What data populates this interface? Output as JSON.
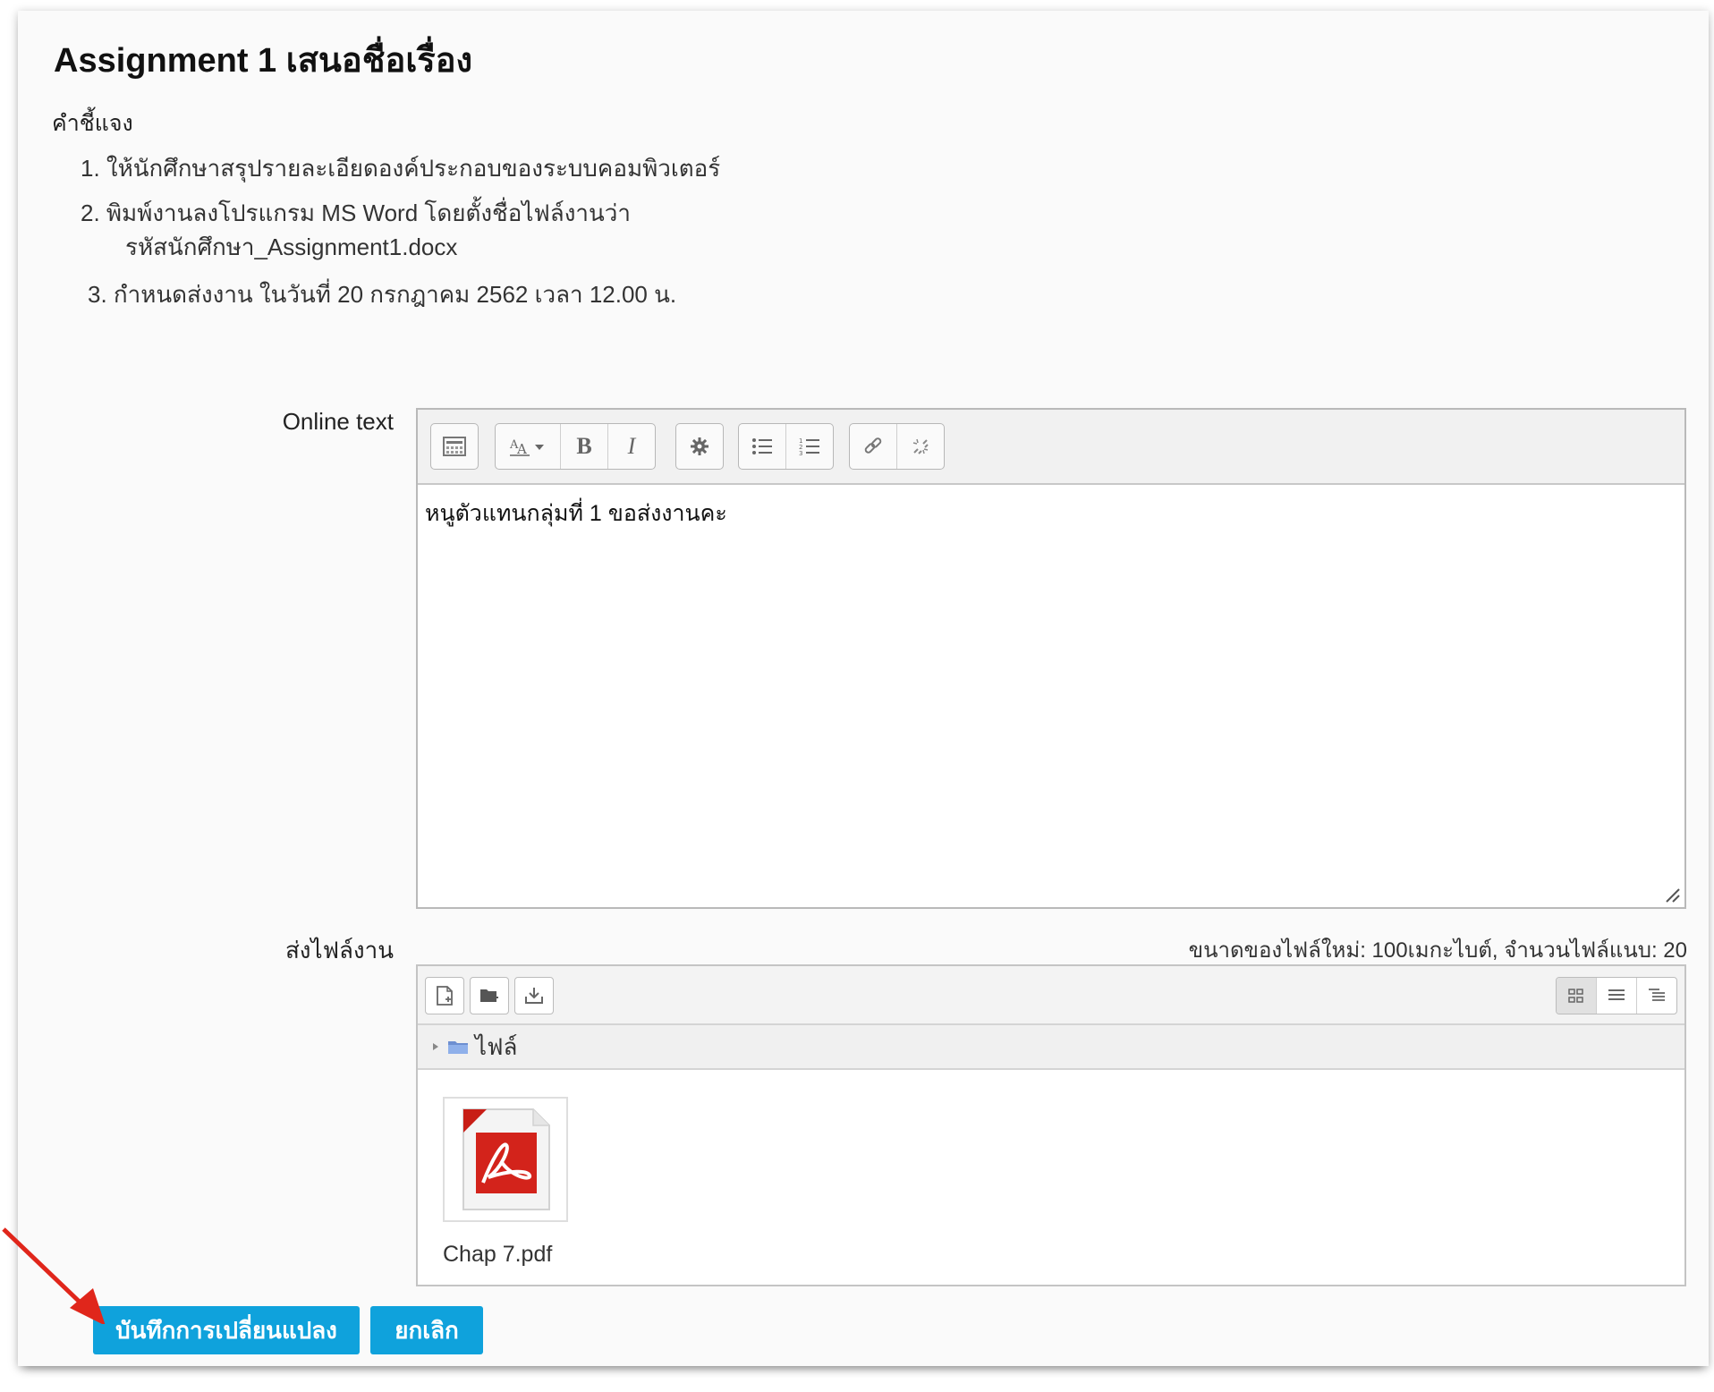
{
  "assignment": {
    "title": "Assignment 1 เสนอชื่อเรื่อง",
    "description_label": "คำชี้แจง",
    "instructions": [
      {
        "number": "1.",
        "text": "ให้นักศึกษาสรุปรายละเอียดองค์ประกอบของระบบคอมพิวเตอร์"
      },
      {
        "number": "2.",
        "text": "พิมพ์งานลงโปรแกรม  MS Word โดยตั้งชื่อไฟล์งานว่า",
        "text2": "รหัสนักศึกษา_Assignment1.docx"
      },
      {
        "number": "3.",
        "text": "กำหนดส่งงาน ในวันที่ 20 กรกฎาคม 2562 เวลา 12.00 น."
      }
    ]
  },
  "online_text": {
    "label": "Online text",
    "content": "หนูตัวแทนกลุ่มที่ 1 ขอส่งงานคะ",
    "toolbar_icons": [
      "toolbar-toggle-icon",
      "font-size-icon",
      "bold-icon",
      "italic-icon",
      "settings-icon",
      "bulleted-list-icon",
      "numbered-list-icon",
      "link-icon",
      "unlink-icon"
    ]
  },
  "file_submission": {
    "label": "ส่งไฟล์งาน",
    "limits": "ขนาดของไฟล์ใหม่: 100เมกะไบต์, จำนวนไฟล์แนบ: 20",
    "path_label": "ไฟล์",
    "files": [
      {
        "name": "Chap 7.pdf",
        "icon": "pdf-icon"
      }
    ]
  },
  "buttons": {
    "save": "บันทึกการเปลี่ยนแปลง",
    "cancel": "ยกเลิก"
  },
  "colors": {
    "primary_button": "#0fa2dc",
    "annotation_arrow": "#e0261b"
  }
}
